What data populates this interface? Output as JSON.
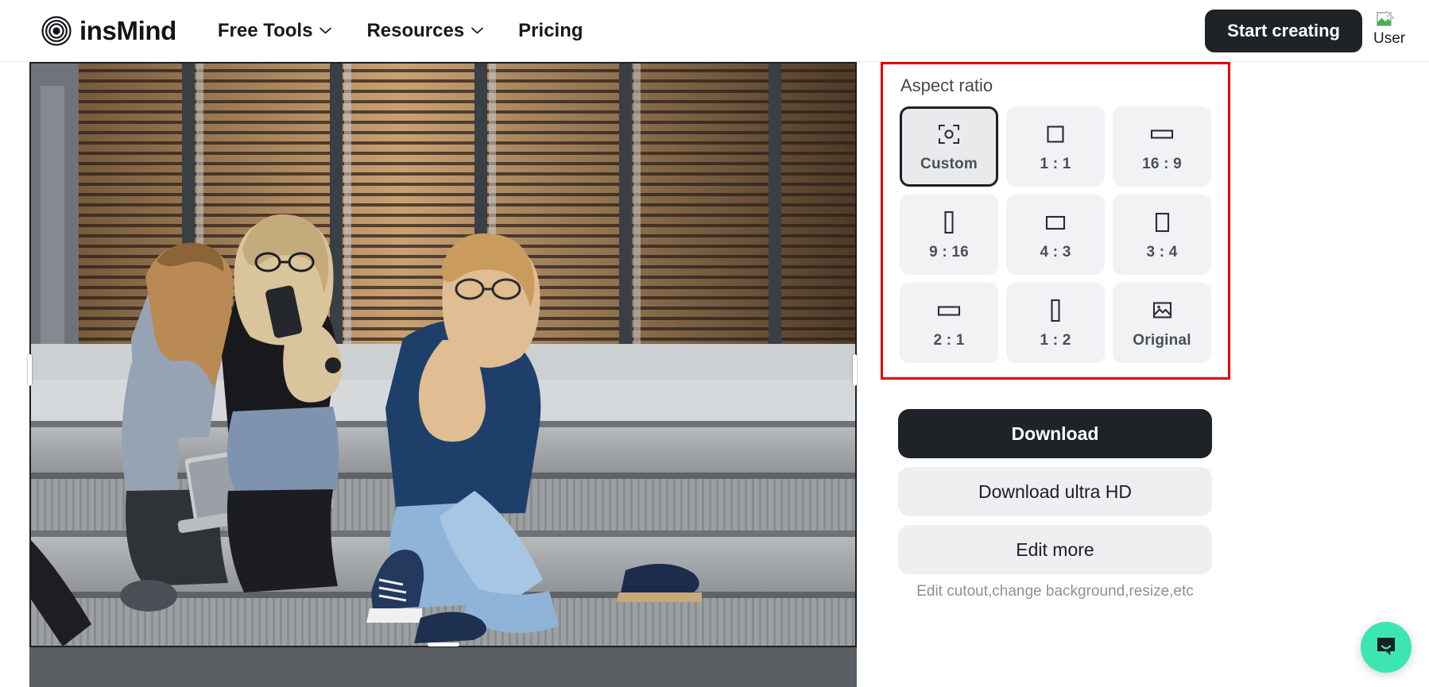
{
  "header": {
    "logo_text": "insMind",
    "logo_icon": "concentric-circles-logo",
    "nav": [
      {
        "label": "Free Tools",
        "has_chevron": true,
        "chevron_icon": "chevron-down-icon"
      },
      {
        "label": "Resources",
        "has_chevron": true,
        "chevron_icon": "chevron-down-icon"
      },
      {
        "label": "Pricing",
        "has_chevron": false
      }
    ],
    "start_button": "Start creating",
    "avatar_alt": "User",
    "avatar_icon": "broken-image-icon"
  },
  "editor": {
    "crop_selection": "custom",
    "scrollbar_visible": true
  },
  "panel": {
    "aspect_ratio": {
      "title": "Aspect ratio",
      "highlight_color": "#e60000",
      "options": [
        {
          "label": "Custom",
          "icon": "focus-frame-icon",
          "shape": "focus",
          "selected": true
        },
        {
          "label": "1 : 1",
          "icon": "square-icon",
          "shape": "sq-1-1",
          "selected": false
        },
        {
          "label": "16 : 9",
          "icon": "wide-rect-icon",
          "shape": "sq-16-9",
          "selected": false
        },
        {
          "label": "9 : 16",
          "icon": "tall-rect-icon",
          "shape": "sq-9-16",
          "selected": false
        },
        {
          "label": "4 : 3",
          "icon": "rect-icon",
          "shape": "sq-4-3",
          "selected": false
        },
        {
          "label": "3 : 4",
          "icon": "portrait-rect-icon",
          "shape": "sq-3-4",
          "selected": false
        },
        {
          "label": "2 : 1",
          "icon": "wide-rect-icon",
          "shape": "sq-2-1",
          "selected": false
        },
        {
          "label": "1 : 2",
          "icon": "tall-rect-icon",
          "shape": "sq-1-2",
          "selected": false
        },
        {
          "label": "Original",
          "icon": "image-icon",
          "shape": "image",
          "selected": false
        }
      ]
    },
    "actions": {
      "download": "Download",
      "download_hd": "Download ultra HD",
      "edit_more": "Edit more",
      "hint": "Edit cutout,change background,resize,etc"
    }
  },
  "chat": {
    "icon": "chat-bubble-smile-icon",
    "color": "#3ce6b0"
  },
  "colors": {
    "accent_dark": "#1f2227",
    "panel_grey": "#f0f2f4",
    "highlight_red": "#e60000",
    "chat_green": "#3ce6b0"
  }
}
